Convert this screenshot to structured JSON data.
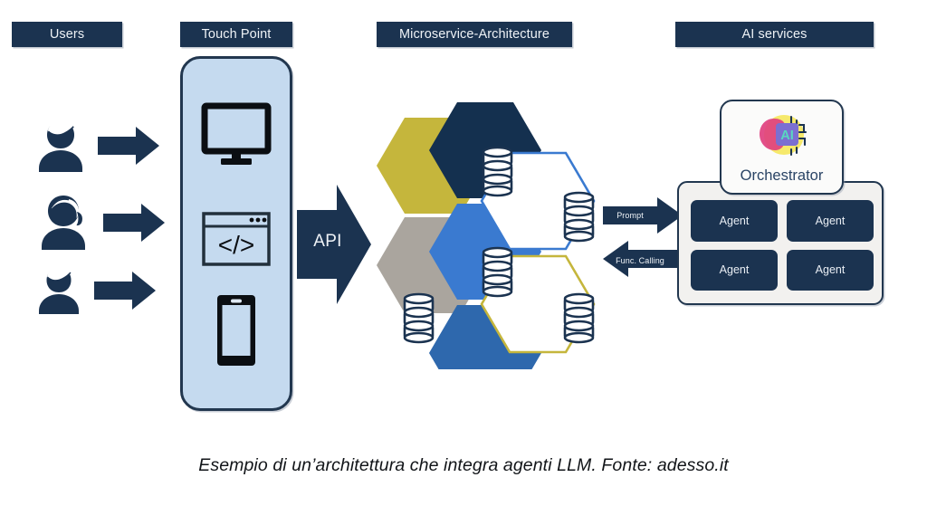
{
  "columns": {
    "users": {
      "title": "Users"
    },
    "touchpoint": {
      "title": "Touch Point"
    },
    "microservice": {
      "title": "Microservice-Architecture"
    },
    "ai": {
      "title": "AI services"
    }
  },
  "users": {
    "people": [
      {
        "icon": "user-person-icon",
        "arrow": "arrow-right-icon"
      },
      {
        "icon": "user-person-female-icon",
        "arrow": "arrow-right-icon"
      },
      {
        "icon": "user-person-icon",
        "arrow": "arrow-right-icon"
      }
    ]
  },
  "touchpoint": {
    "icons": [
      {
        "name": "desktop-monitor-icon"
      },
      {
        "name": "code-browser-icon",
        "glyph": "</>"
      },
      {
        "name": "smartphone-icon"
      }
    ]
  },
  "api": {
    "label": "API",
    "icon": "api-arrow-icon"
  },
  "microservice": {
    "hexagons": [
      {
        "id": "hex-yellow",
        "style": "filled",
        "color": "#c5b63c"
      },
      {
        "id": "hex-navy",
        "style": "filled",
        "color": "#14304f"
      },
      {
        "id": "hex-gray",
        "style": "filled",
        "color": "#aaa59e"
      },
      {
        "id": "hex-blue-light",
        "style": "filled",
        "color": "#3a7ad0"
      },
      {
        "id": "hex-blue-dark",
        "style": "filled",
        "color": "#2e68ad"
      },
      {
        "id": "hex-outline-blue",
        "style": "outline",
        "color": "#3a7ad0"
      },
      {
        "id": "hex-outline-yellow",
        "style": "outline",
        "color": "#c5b63c"
      }
    ],
    "databases": [
      {
        "name": "database-icon"
      },
      {
        "name": "database-icon"
      },
      {
        "name": "database-icon"
      },
      {
        "name": "database-icon"
      },
      {
        "name": "database-icon"
      }
    ]
  },
  "flow": {
    "prompt": {
      "label": "Prompt",
      "icon": "arrow-right-icon"
    },
    "function_calling": {
      "label": "Func. Calling",
      "icon": "arrow-left-icon"
    }
  },
  "ai_services": {
    "orchestrator": {
      "label": "Orchestrator",
      "icon": "ai-chip-icon",
      "chip_text": "AI"
    },
    "agents": [
      {
        "label": "Agent"
      },
      {
        "label": "Agent"
      },
      {
        "label": "Agent"
      },
      {
        "label": "Agent"
      }
    ]
  },
  "caption": "Esempio di un’architettura che integra agenti LLM. Fonte: adesso.it",
  "colors": {
    "navy": "#1b3350",
    "navy_dark": "#14304f",
    "panel_blue": "#c5daef",
    "panel_gray": "#f2f1ef",
    "yellow": "#c5b63c",
    "blue_light": "#3a7ad0",
    "blue_dark": "#2e68ad",
    "gray": "#aaa59e"
  }
}
